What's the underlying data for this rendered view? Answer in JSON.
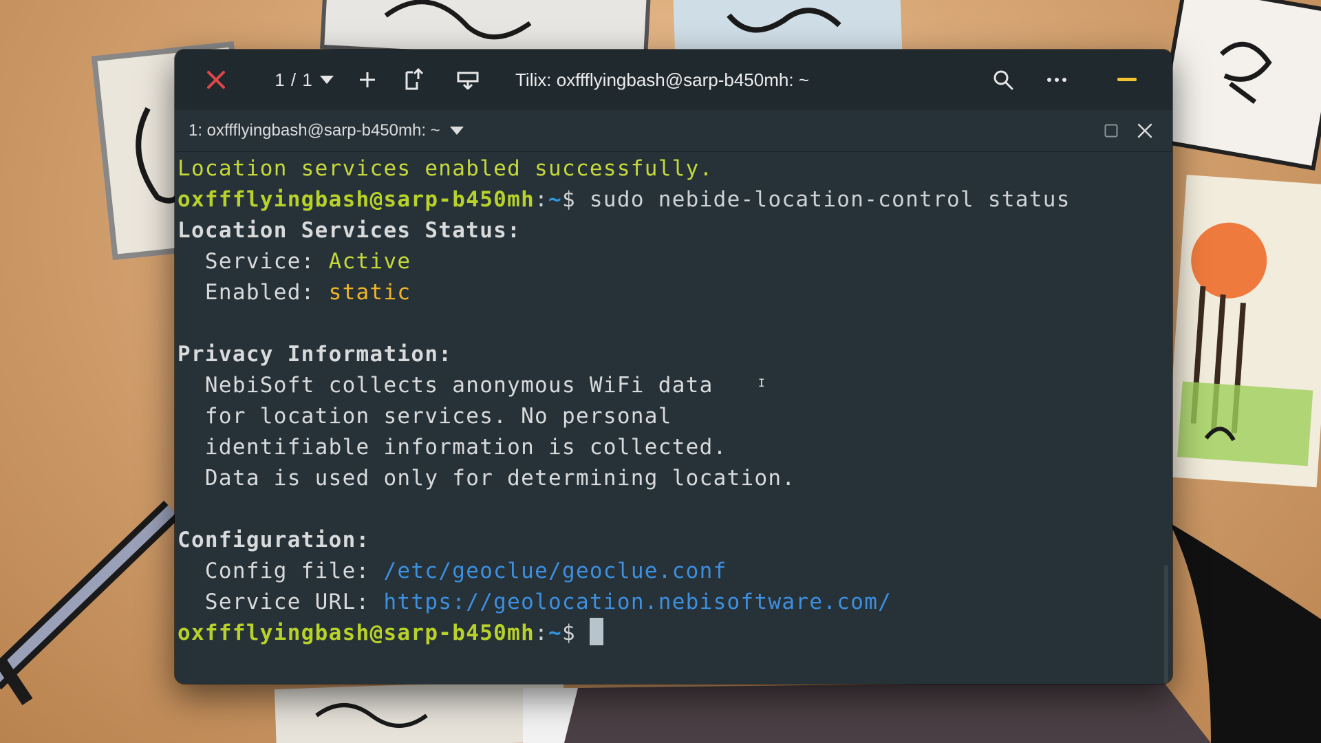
{
  "header": {
    "session_count": "1 / 1",
    "window_title": "Tilix: oxffflyingbash@sarp-b450mh: ~",
    "icons": {
      "close": "close-icon",
      "session_dropdown": "chevron-down-icon",
      "add": "plus-icon",
      "split_horizontal": "split-horizontal-icon",
      "split_vertical": "split-vertical-icon",
      "search": "search-icon",
      "more": "more-icon",
      "minimize": "minimize-icon"
    }
  },
  "terminal_tab": {
    "title": "1: oxffflyingbash@sarp-b450mh: ~"
  },
  "terminal": {
    "line1": "Location services enabled successfully.",
    "prompt_user": "oxffflyingbash@sarp-b450mh",
    "prompt_sep": ":",
    "prompt_path": "~",
    "prompt_symbol": "$",
    "command": " sudo nebide-location-control status",
    "status_heading": "Location Services Status:",
    "service_label": "  Service: ",
    "service_value": "Active",
    "enabled_label": "  Enabled: ",
    "enabled_value": "static",
    "privacy_heading": "Privacy Information:",
    "privacy_1": "  NebiSoft collects anonymous WiFi data",
    "privacy_2": "  for location services. No personal",
    "privacy_3": "  identifiable information is collected.",
    "privacy_4": "  Data is used only for determining location.",
    "config_heading": "Configuration:",
    "config_file_label": "  Config file: ",
    "config_file_value": "/etc/geoclue/geoclue.conf",
    "service_url_label": "  Service URL: ",
    "service_url_value": "https://geolocation.nebisoftware.com/"
  },
  "colors": {
    "terminal_bg": "#263238",
    "headerbar_bg": "#1f292e",
    "success_text": "#c6d93a",
    "prompt_user": "#b8d22a",
    "prompt_path": "#2f96e0",
    "value_active": "#c6d93a",
    "value_static": "#f0b429",
    "link": "#3d8fe0",
    "close_red": "#e0484a",
    "minimize_yellow": "#f2c230"
  }
}
